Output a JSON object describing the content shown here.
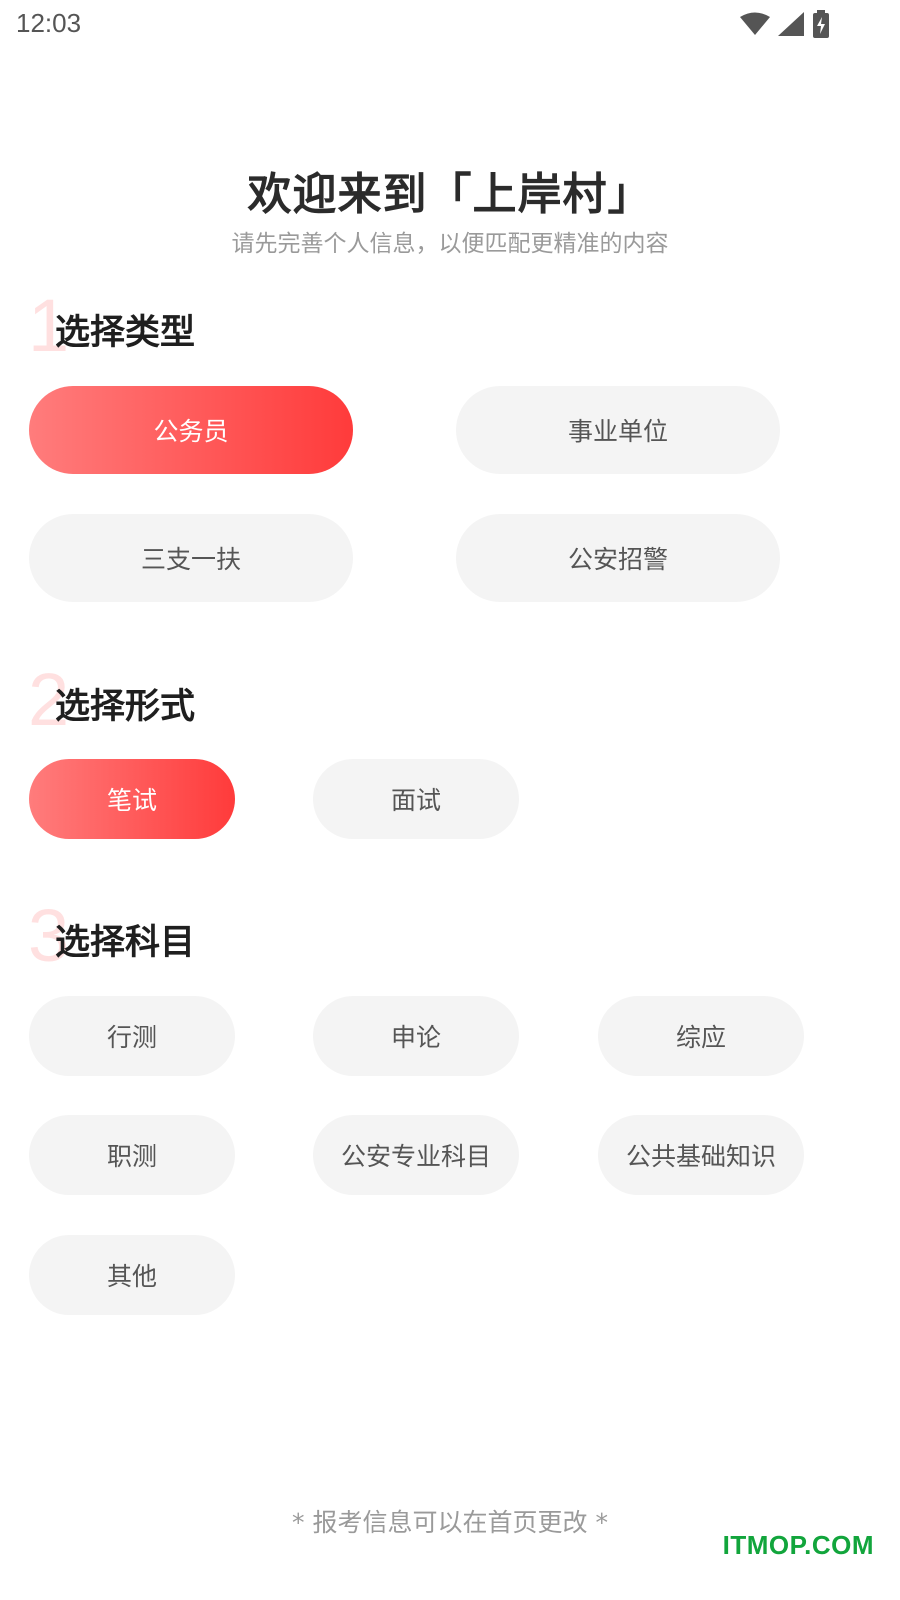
{
  "status_bar": {
    "time": "12:03",
    "icons": [
      "wifi-icon",
      "cellular-signal-icon",
      "battery-charging-icon"
    ]
  },
  "header": {
    "title": "欢迎来到「上岸村」",
    "subtitle": "请先完善个人信息，以便匹配更精准的内容"
  },
  "sections": [
    {
      "number": "1",
      "title": "选择类型",
      "options": [
        {
          "label": "公务员",
          "selected": true
        },
        {
          "label": "事业单位",
          "selected": false
        },
        {
          "label": "三支一扶",
          "selected": false
        },
        {
          "label": "公安招警",
          "selected": false
        }
      ]
    },
    {
      "number": "2",
      "title": "选择形式",
      "options": [
        {
          "label": "笔试",
          "selected": true
        },
        {
          "label": "面试",
          "selected": false
        }
      ]
    },
    {
      "number": "3",
      "title": "选择科目",
      "options": [
        {
          "label": "行测",
          "selected": false
        },
        {
          "label": "申论",
          "selected": false
        },
        {
          "label": "综应",
          "selected": false
        },
        {
          "label": "职测",
          "selected": false
        },
        {
          "label": "公安专业科目",
          "selected": false
        },
        {
          "label": "公共基础知识",
          "selected": false
        },
        {
          "label": "其他",
          "selected": false
        }
      ]
    }
  ],
  "footer": {
    "note": "* 报考信息可以在首页更改 *"
  },
  "watermark": "ITMOP.COM",
  "colors": {
    "accent_start": "#ff7c7c",
    "accent_end": "#ff3b3b",
    "chip_background": "#f4f4f4",
    "section_number": "#ffe0e0",
    "watermark": "#12a53c"
  }
}
